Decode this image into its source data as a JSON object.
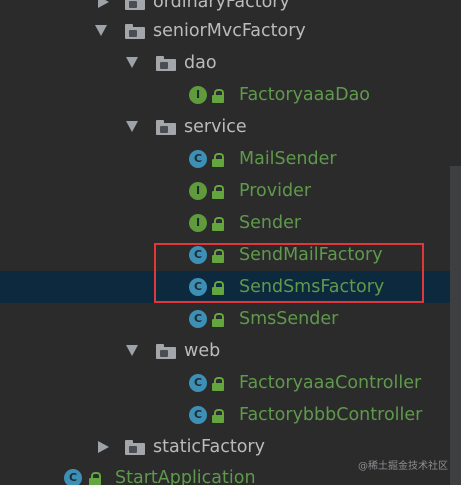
{
  "tree": {
    "rows": [
      {
        "label": "ordinaryFactory",
        "kind": "package",
        "expanded": false,
        "icon": "folder-icon"
      },
      {
        "label": "seniorMvcFactory",
        "kind": "package",
        "expanded": true,
        "icon": "folder-icon"
      },
      {
        "label": "dao",
        "kind": "package",
        "expanded": true,
        "icon": "folder-icon"
      },
      {
        "label": "FactoryaaaDao",
        "kind": "interface",
        "badge": "I"
      },
      {
        "label": "service",
        "kind": "package",
        "expanded": true,
        "icon": "folder-icon"
      },
      {
        "label": "MailSender",
        "kind": "class",
        "badge": "C"
      },
      {
        "label": "Provider",
        "kind": "interface",
        "badge": "I"
      },
      {
        "label": "Sender",
        "kind": "interface",
        "badge": "I"
      },
      {
        "label": "SendMailFactory",
        "kind": "class",
        "badge": "C"
      },
      {
        "label": "SendSmsFactory",
        "kind": "class",
        "badge": "C",
        "selected": true
      },
      {
        "label": "SmsSender",
        "kind": "class",
        "badge": "C"
      },
      {
        "label": "web",
        "kind": "package",
        "expanded": true,
        "icon": "folder-icon"
      },
      {
        "label": "FactoryaaaController",
        "kind": "class",
        "badge": "C"
      },
      {
        "label": "FactorybbbController",
        "kind": "class",
        "badge": "C"
      },
      {
        "label": "staticFactory",
        "kind": "package",
        "expanded": false,
        "icon": "folder-icon"
      },
      {
        "label": "StartApplication",
        "kind": "application",
        "badge": "C"
      }
    ]
  },
  "colors": {
    "background": "#2b2b2b",
    "selected_row": "#0d293e",
    "class_text": "#5f9a4c",
    "package_text": "#bbbbbb",
    "class_badge": "#3d8fb6",
    "interface_badge": "#5f9a3c",
    "highlight_border": "#e0383a"
  },
  "watermark": "@稀土掘金技术社区"
}
